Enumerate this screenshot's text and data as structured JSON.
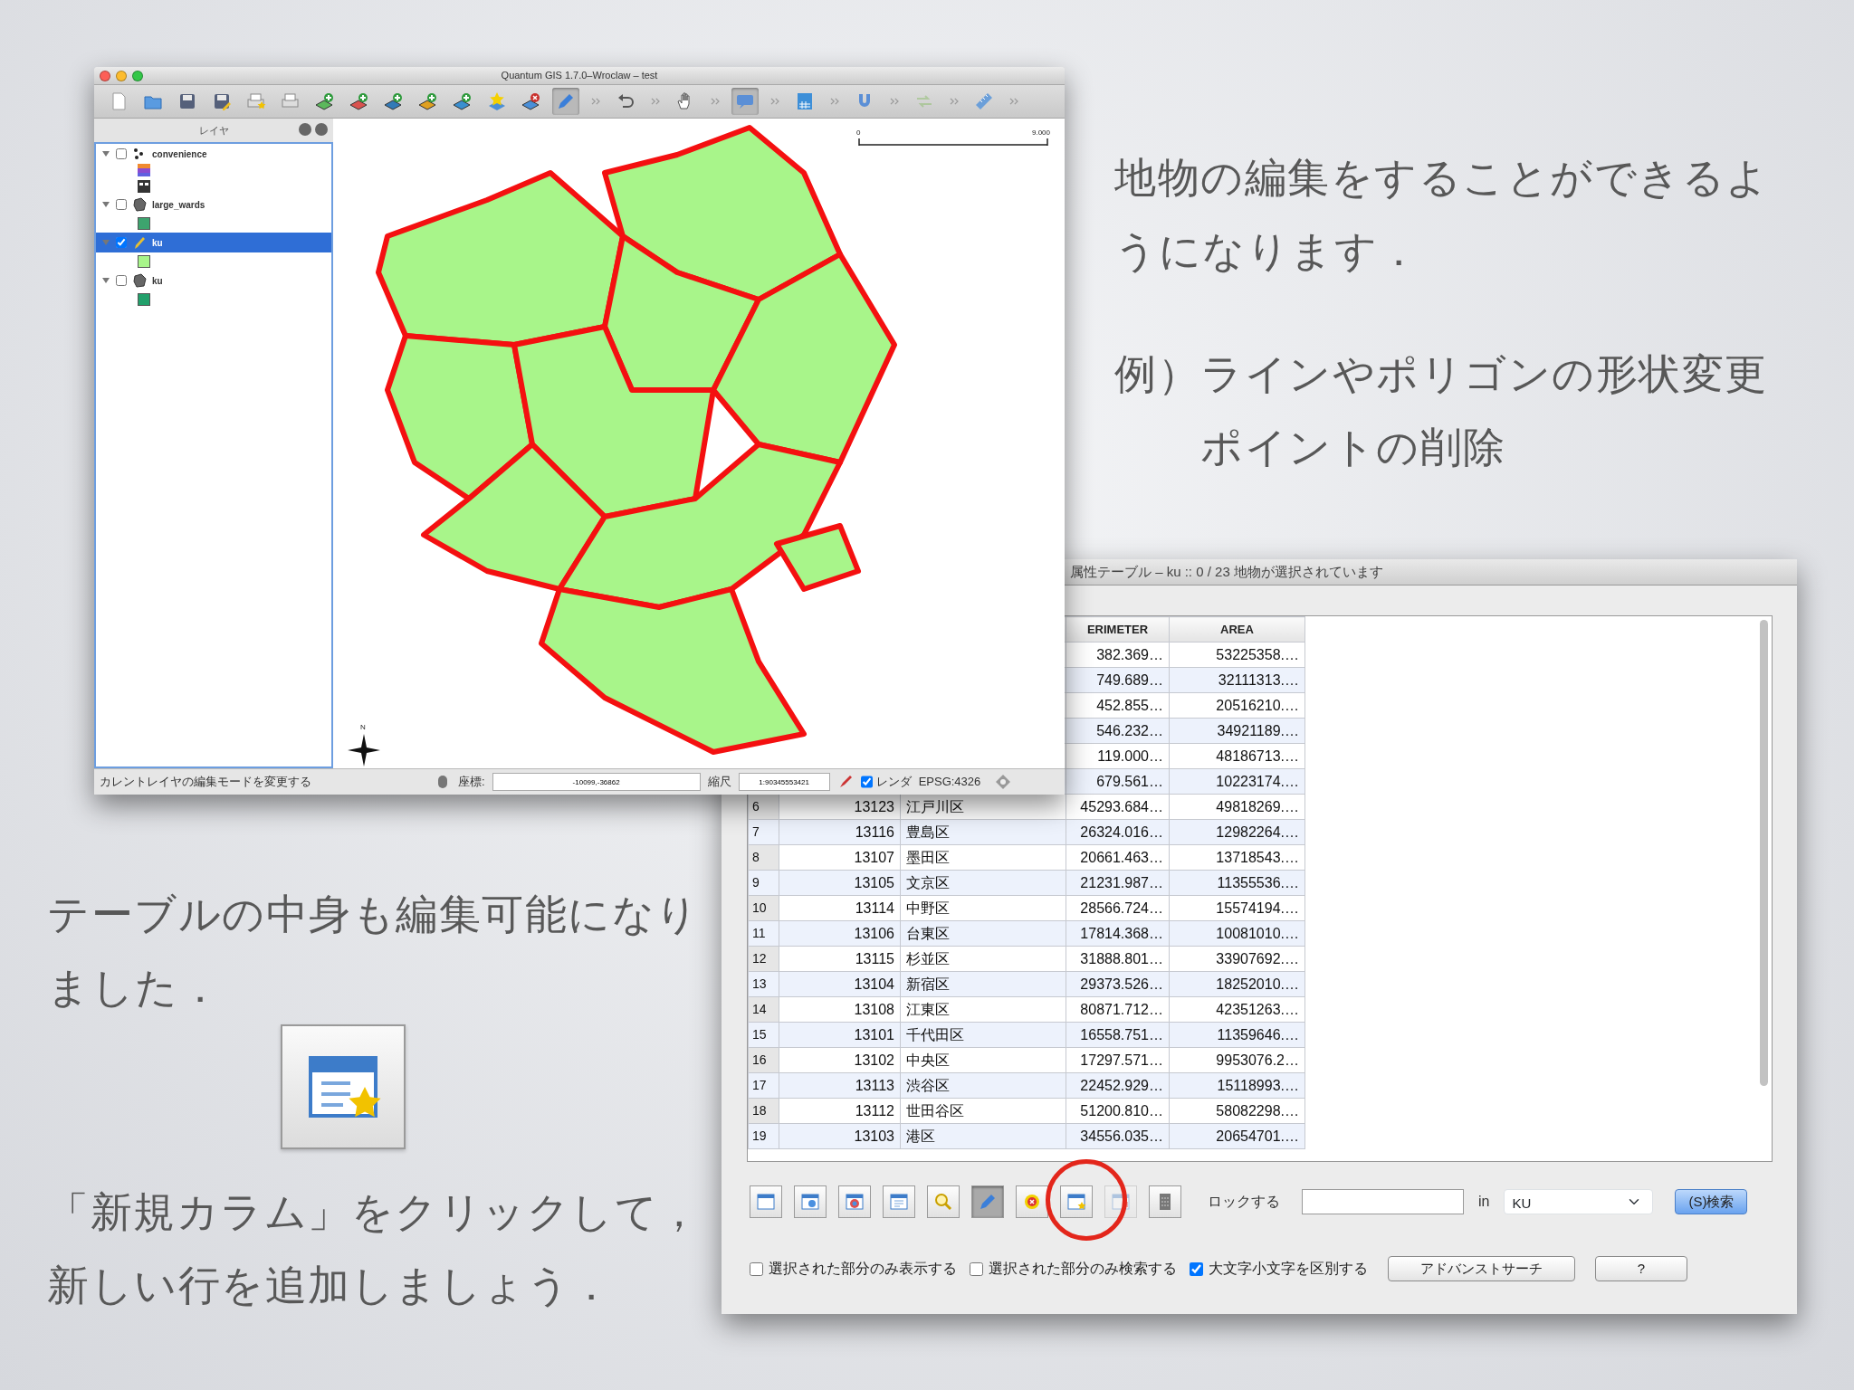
{
  "slide": {
    "intro": "地物の編集をすることができるようになります．",
    "example_label": "例）",
    "examples": [
      "ラインやポリゴンの形状変更",
      "ポイントの削除"
    ],
    "table_note": "テーブルの中身も編集可能になりました．",
    "instruction": "「新規カラム」をクリックして，新しい行を追加しましょう．"
  },
  "qgis_window": {
    "title": "Quantum GIS 1.7.0–Wroclaw – test",
    "toolbar": [
      {
        "kind": "new",
        "pressed": false,
        "disabled": false
      },
      {
        "kind": "open",
        "pressed": false,
        "disabled": false
      },
      {
        "kind": "save",
        "pressed": false,
        "disabled": false
      },
      {
        "kind": "save_as",
        "pressed": false,
        "disabled": false
      },
      {
        "kind": "composer",
        "pressed": false,
        "disabled": false
      },
      {
        "kind": "print",
        "pressed": false,
        "disabled": false
      },
      {
        "kind": "add_vector",
        "pressed": false,
        "disabled": false
      },
      {
        "kind": "add_raster",
        "pressed": false,
        "disabled": false
      },
      {
        "kind": "add_postgis",
        "pressed": false,
        "disabled": false
      },
      {
        "kind": "add_spatialite",
        "pressed": false,
        "disabled": false
      },
      {
        "kind": "add_wms",
        "pressed": false,
        "disabled": false
      },
      {
        "kind": "new_layer",
        "pressed": false,
        "disabled": false
      },
      {
        "kind": "remove_layer",
        "pressed": false,
        "disabled": false
      },
      {
        "kind": "edit",
        "pressed": true,
        "disabled": false
      },
      {
        "kind": "more",
        "pressed": false,
        "disabled": false
      },
      {
        "kind": "undo",
        "pressed": false,
        "disabled": false
      },
      {
        "kind": "more",
        "pressed": false,
        "disabled": false
      },
      {
        "kind": "pan",
        "pressed": false,
        "disabled": false
      },
      {
        "kind": "more",
        "pressed": false,
        "disabled": false
      },
      {
        "kind": "map_tips",
        "pressed": true,
        "disabled": false
      },
      {
        "kind": "more",
        "pressed": false,
        "disabled": false
      },
      {
        "kind": "table",
        "pressed": false,
        "disabled": false
      },
      {
        "kind": "more",
        "pressed": false,
        "disabled": false
      },
      {
        "kind": "snapping",
        "pressed": false,
        "disabled": false
      },
      {
        "kind": "more",
        "pressed": false,
        "disabled": false
      },
      {
        "kind": "arrows",
        "pressed": false,
        "disabled": true
      },
      {
        "kind": "more",
        "pressed": false,
        "disabled": false
      },
      {
        "kind": "measure",
        "pressed": false,
        "disabled": false
      },
      {
        "kind": "more",
        "pressed": false,
        "disabled": false
      }
    ],
    "layers_panel": {
      "title": "レイヤ",
      "layers": [
        {
          "name": "convenience",
          "kind": "point",
          "checked": false,
          "selected": false,
          "expanded": true
        },
        {
          "name": "large_wards",
          "kind": "polygon",
          "checked": false,
          "selected": false,
          "expanded": true,
          "color": "#3da46e"
        },
        {
          "name": "ku",
          "kind": "editing",
          "checked": true,
          "selected": true,
          "expanded": true,
          "color": "#a8f58a"
        },
        {
          "name": "ku",
          "kind": "polygon",
          "checked": false,
          "selected": false,
          "expanded": true,
          "color": "#22a06b"
        }
      ]
    },
    "map": {
      "scale_labels": [
        "0",
        "9.000"
      ],
      "north_label": "N"
    },
    "status_bar": {
      "message": "カレントレイヤの編集モードを変更する",
      "coordinate_label": "座標:",
      "coordinate": "-10099,-36862",
      "scale_label": "縮尺",
      "scale": "1:90345553421",
      "render_label": "レンダ",
      "render_checked": true,
      "crs": "EPSG:4326"
    }
  },
  "attribute_window": {
    "title": "属性テーブル – ku :: 0 / 23 地物が選択されています",
    "columns": [
      "ERIMETER",
      "AREA"
    ],
    "rows": [
      {
        "perimeter": "382.369…",
        "area": "53225358.…"
      },
      {
        "perimeter": "749.689…",
        "area": "32111313.…"
      },
      {
        "perimeter": "452.855…",
        "area": "20516210.…"
      },
      {
        "perimeter": "546.232…",
        "area": "34921189.…"
      },
      {
        "perimeter": "119.000…",
        "area": "48186713.…"
      },
      {
        "perimeter": "679.561…",
        "area": "10223174.…"
      },
      {
        "number": "6",
        "id": "13123",
        "name": "江戸川区",
        "perimeter": "45293.684…",
        "area": "49818269.…"
      },
      {
        "number": "7",
        "id": "13116",
        "name": "豊島区",
        "perimeter": "26324.016…",
        "area": "12982264.…"
      },
      {
        "number": "8",
        "id": "13107",
        "name": "墨田区",
        "perimeter": "20661.463…",
        "area": "13718543.…"
      },
      {
        "number": "9",
        "id": "13105",
        "name": "文京区",
        "perimeter": "21231.987…",
        "area": "11355536.…"
      },
      {
        "number": "10",
        "id": "13114",
        "name": "中野区",
        "perimeter": "28566.724…",
        "area": "15574194.…"
      },
      {
        "number": "11",
        "id": "13106",
        "name": "台東区",
        "perimeter": "17814.368…",
        "area": "10081010.…"
      },
      {
        "number": "12",
        "id": "13115",
        "name": "杉並区",
        "perimeter": "31888.801…",
        "area": "33907692.…"
      },
      {
        "number": "13",
        "id": "13104",
        "name": "新宿区",
        "perimeter": "29373.526…",
        "area": "18252010.…"
      },
      {
        "number": "14",
        "id": "13108",
        "name": "江東区",
        "perimeter": "80871.712…",
        "area": "42351263.…"
      },
      {
        "number": "15",
        "id": "13101",
        "name": "千代田区",
        "perimeter": "16558.751…",
        "area": "11359646.…"
      },
      {
        "number": "16",
        "id": "13102",
        "name": "中央区",
        "perimeter": "17297.571…",
        "area": "9953076.2…"
      },
      {
        "number": "17",
        "id": "13113",
        "name": "渋谷区",
        "perimeter": "22452.929…",
        "area": "15118993.…"
      },
      {
        "number": "18",
        "id": "13112",
        "name": "世田谷区",
        "perimeter": "51200.810…",
        "area": "58082298.…"
      },
      {
        "number": "19",
        "id": "13103",
        "name": "港区",
        "perimeter": "34556.035…",
        "area": "20654701.…"
      }
    ],
    "toolbar": [
      {
        "kind": "window",
        "pressed": false,
        "disabled": false
      },
      {
        "kind": "window_arrow",
        "pressed": false,
        "disabled": false
      },
      {
        "kind": "window_globe",
        "pressed": false,
        "disabled": false
      },
      {
        "kind": "window_doc",
        "pressed": false,
        "disabled": false
      },
      {
        "kind": "zoom",
        "pressed": false,
        "disabled": false
      },
      {
        "kind": "edit",
        "pressed": true,
        "disabled": false
      },
      {
        "kind": "delete",
        "pressed": false,
        "disabled": false
      },
      {
        "kind": "new_column",
        "pressed": false,
        "disabled": false
      },
      {
        "kind": "delete_column",
        "pressed": false,
        "disabled": true
      },
      {
        "kind": "calculator",
        "pressed": false,
        "disabled": false
      }
    ],
    "lock_label": "ロックする",
    "in_label": "in",
    "field": "KU",
    "search_button": "(S)検索",
    "options": [
      {
        "label": "選択された部分のみ表示する",
        "checked": false
      },
      {
        "label": "選択された部分のみ検索する",
        "checked": false
      },
      {
        "label": "大文字小文字を区別する",
        "checked": true
      }
    ],
    "advanced_button": "アドバンストサーチ",
    "help_button": "?"
  }
}
